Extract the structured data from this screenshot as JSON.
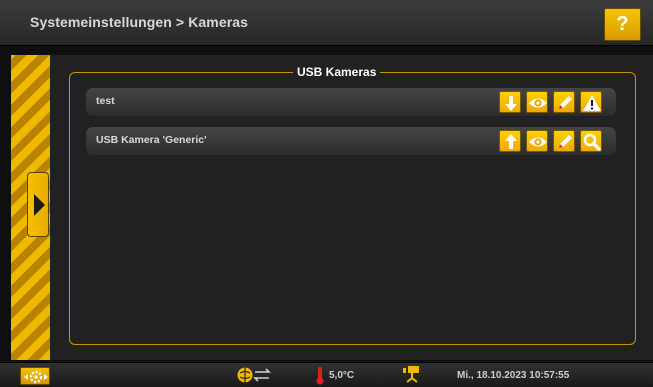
{
  "header": {
    "title": "Systemeinstellungen > Kameras",
    "help_label": "?"
  },
  "usb_cameras": {
    "legend": "USB Kameras",
    "rows": [
      {
        "label": "test",
        "actions": [
          "arrow-down-icon",
          "eye-icon",
          "pencil-icon",
          "warning-icon"
        ]
      },
      {
        "label": "USB Kamera 'Generic'",
        "actions": [
          "arrow-up-icon",
          "eye-icon",
          "pencil-icon",
          "search-icon"
        ]
      }
    ]
  },
  "footer": {
    "temperature": "5,0°C",
    "datetime": "Mi., 18.10.2023 10:57:55",
    "icons": [
      "settings-icon",
      "network-icon",
      "thermometer-icon",
      "camera-icon"
    ]
  },
  "colors": {
    "accent": "#f3b800",
    "header_bg": "#333333",
    "panel_bg": "#212121",
    "border": "#c8960a",
    "thermometer": "#e02020"
  }
}
